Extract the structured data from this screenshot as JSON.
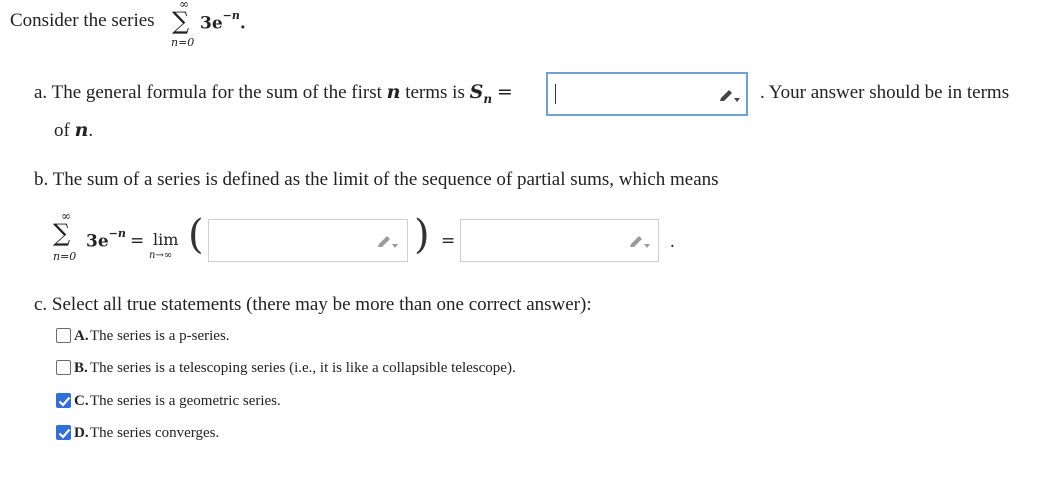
{
  "intro": {
    "text": "Consider the series",
    "sum_upper": "∞",
    "sum_lower": "n=0",
    "term": "3e",
    "term_exp": "−n",
    "period": "."
  },
  "part_a": {
    "prefix": "a. The general formula for the sum of the first",
    "var_n": "n",
    "middle": "terms is",
    "sn_base": "S",
    "sn_sub": "n",
    "equals": "=",
    "input_value": "",
    "suffix": ". Your answer should be in terms",
    "line2_prefix": "of",
    "line2_var": "n",
    "line2_suffix": "."
  },
  "part_b": {
    "text": "b. The sum of a series is defined as the limit of the sequence of partial sums, which means",
    "sum_upper": "∞",
    "sum_lower": "n=0",
    "term": "3e",
    "term_exp": "−n",
    "equals1": "=",
    "lim": "lim",
    "lim_sub": "n→∞",
    "equals2": "=",
    "input1_value": "",
    "input2_value": "",
    "end_period": "."
  },
  "part_c": {
    "prompt": "c. Select all true statements (there may be more than one correct answer):",
    "options": [
      {
        "letter": "A.",
        "label": "The series is a p-series.",
        "checked": false
      },
      {
        "letter": "B.",
        "label": "The series is a telescoping series (i.e., it is like a collapsible telescope).",
        "checked": false
      },
      {
        "letter": "C.",
        "label": "The series is a geometric series.",
        "checked": true
      },
      {
        "letter": "D.",
        "label": "The series converges.",
        "checked": true
      }
    ]
  },
  "icons": {
    "edit": "pencil-dropdown-icon",
    "checkmark": "checkmark-icon"
  },
  "colors": {
    "active_border": "#6fa3d8",
    "checkbox_checked": "#2f6fd6",
    "text": "#222222"
  }
}
